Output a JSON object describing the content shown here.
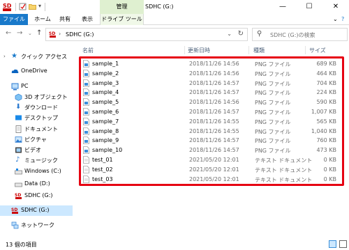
{
  "titlebar": {
    "title": "SDHC (G:)",
    "manage_tab": "管理",
    "minimize": "—",
    "maximize": "☐",
    "close": "✕"
  },
  "ribbon": {
    "tabs": [
      "ファイル",
      "ホーム",
      "共有",
      "表示",
      "ドライブ ツール"
    ],
    "expand": "⌄",
    "help": "?"
  },
  "address": {
    "path_label": "SDHC (G:)",
    "search_placeholder": "SDHC (G:)の検索"
  },
  "sidebar": {
    "items": [
      {
        "label": "クイック アクセス",
        "icon": "star-icon"
      },
      {
        "label": "OneDrive",
        "icon": "cloud-icon"
      },
      {
        "label": "PC",
        "icon": "pc-icon"
      },
      {
        "label": "3D オブジェクト",
        "icon": "cube-icon"
      },
      {
        "label": "ダウンロード",
        "icon": "download-icon"
      },
      {
        "label": "デスクトップ",
        "icon": "desktop-icon"
      },
      {
        "label": "ドキュメント",
        "icon": "documents-icon"
      },
      {
        "label": "ピクチャ",
        "icon": "pictures-icon"
      },
      {
        "label": "ビデオ",
        "icon": "video-icon"
      },
      {
        "label": "ミュージック",
        "icon": "music-icon"
      },
      {
        "label": "Windows (C:)",
        "icon": "drive-icon"
      },
      {
        "label": "Data (D:)",
        "icon": "drive-icon"
      },
      {
        "label": "SDHC (G:)",
        "icon": "sd-card-icon"
      },
      {
        "label": "SDHC (G:)",
        "icon": "sd-card-icon"
      },
      {
        "label": "ネットワーク",
        "icon": "network-icon"
      }
    ]
  },
  "columns": {
    "name": "名前",
    "date": "更新日時",
    "type": "種類",
    "size": "サイズ"
  },
  "files": [
    {
      "name": "sample_1",
      "date": "2018/11/26 14:56",
      "type": "PNG ファイル",
      "size": "689 KB",
      "kind": "png"
    },
    {
      "name": "sample_2",
      "date": "2018/11/26 14:56",
      "type": "PNG ファイル",
      "size": "464 KB",
      "kind": "png"
    },
    {
      "name": "sample_3",
      "date": "2018/11/26 14:57",
      "type": "PNG ファイル",
      "size": "704 KB",
      "kind": "png"
    },
    {
      "name": "sample_4",
      "date": "2018/11/26 14:57",
      "type": "PNG ファイル",
      "size": "224 KB",
      "kind": "png"
    },
    {
      "name": "sample_5",
      "date": "2018/11/26 14:56",
      "type": "PNG ファイル",
      "size": "590 KB",
      "kind": "png"
    },
    {
      "name": "sample_6",
      "date": "2018/11/26 14:57",
      "type": "PNG ファイル",
      "size": "1,007 KB",
      "kind": "png"
    },
    {
      "name": "sample_7",
      "date": "2018/11/26 14:55",
      "type": "PNG ファイル",
      "size": "565 KB",
      "kind": "png"
    },
    {
      "name": "sample_8",
      "date": "2018/11/26 14:55",
      "type": "PNG ファイル",
      "size": "1,040 KB",
      "kind": "png"
    },
    {
      "name": "sample_9",
      "date": "2018/11/26 14:57",
      "type": "PNG ファイル",
      "size": "760 KB",
      "kind": "png"
    },
    {
      "name": "sample_10",
      "date": "2018/11/26 14:57",
      "type": "PNG ファイル",
      "size": "473 KB",
      "kind": "png"
    },
    {
      "name": "test_01",
      "date": "2021/05/20 12:01",
      "type": "テキスト ドキュメント",
      "size": "0 KB",
      "kind": "txt"
    },
    {
      "name": "test_02",
      "date": "2021/05/20 12:01",
      "type": "テキスト ドキュメント",
      "size": "0 KB",
      "kind": "txt"
    },
    {
      "name": "test_03",
      "date": "2021/05/20 12:01",
      "type": "テキスト ドキュメント",
      "size": "0 KB",
      "kind": "txt"
    }
  ],
  "status": {
    "item_count": "13 個の項目"
  },
  "colors": {
    "accent": "#1979ca",
    "highlight": "#e60012",
    "manage_tab_bg": "#dff0d0",
    "selected_bg": "#cce8ff"
  }
}
